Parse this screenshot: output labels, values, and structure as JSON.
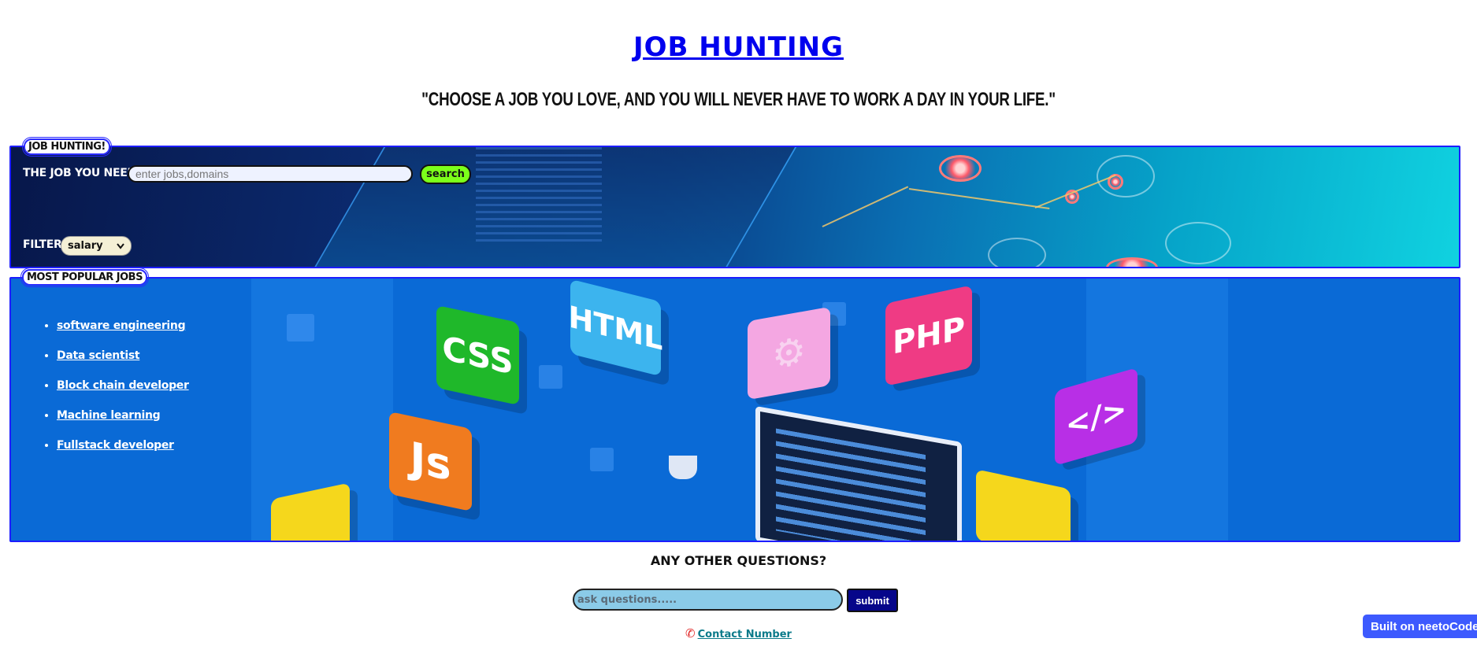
{
  "header": {
    "title": "JOB HUNTING",
    "quote": "\"CHOOSE A JOB YOU LOVE, AND YOU WILL NEVER HAVE TO WORK A DAY IN YOUR LIFE.\""
  },
  "hero": {
    "legend": "JOB HUNTING!",
    "search_label": "THE JOB YOU NEED",
    "search_placeholder": "enter jobs,domains",
    "search_button": "search",
    "filter_label": "FILTER",
    "filter_selected": "salary"
  },
  "popular": {
    "legend": "MOST POPULAR JOBS",
    "jobs": [
      "software engineering",
      "Data scientist",
      "Block chain developer",
      "Machine learning",
      "Fullstack developer"
    ],
    "tech_labels": [
      "CSS",
      "HTML",
      "PHP",
      "Js",
      "</>"
    ]
  },
  "questions": {
    "title": "ANY OTHER QUESTIONS?",
    "placeholder": "ask questions.....",
    "submit": "submit"
  },
  "footer": {
    "contact": "Contact Number",
    "badge": "Built on neetoCode"
  },
  "icons": {
    "phone": "phone-icon",
    "filter_chevron": "chevron-down-icon",
    "gear": "gear-icon"
  }
}
